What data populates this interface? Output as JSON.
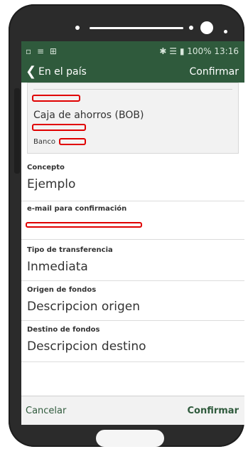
{
  "status": {
    "icons_left": "▫ ≡ ⊞",
    "battery": "100%",
    "time": "13:16",
    "icons_right": "✱ ☰ ▮"
  },
  "appbar": {
    "back_label": "En el país",
    "confirm_label": "Confirmar"
  },
  "bank": {
    "type": "Caja de ahorros (BOB)",
    "bank_label": "Banco"
  },
  "fields": [
    {
      "label": "Concepto",
      "value": "Ejemplo"
    },
    {
      "label": "e-mail para confirmación",
      "value": ""
    },
    {
      "label": "Tipo de transferencia",
      "value": "Inmediata"
    },
    {
      "label": "Origen de fondos",
      "value": "Descripcion origen"
    },
    {
      "label": "Destino de fondos",
      "value": "Descripcion destino"
    }
  ],
  "footer": {
    "cancel_label": "Cancelar",
    "confirm_label": "Confirmar"
  },
  "colors": {
    "header": "#2f5a3c",
    "redaction": "#e00000"
  }
}
